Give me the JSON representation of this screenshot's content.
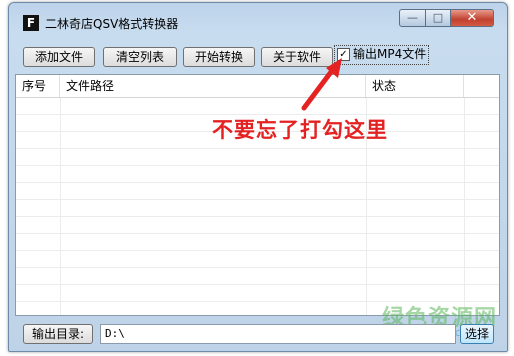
{
  "window": {
    "title": "二林奇店QSV格式转换器",
    "app_icon_letter": "F",
    "controls": {
      "minimize": "—",
      "maximize": "□",
      "close": "✕"
    }
  },
  "toolbar": {
    "add_file": "添加文件",
    "clear_list": "清空列表",
    "start_convert": "开始转换",
    "about": "关于软件",
    "output_mp4_label": "输出MP4文件",
    "output_mp4_checked": "✓"
  },
  "file_list": {
    "columns": [
      "序号",
      "文件路径",
      "状态"
    ],
    "rows": []
  },
  "annotation": {
    "text": "不要忘了打勾这里",
    "color": "#e42222"
  },
  "bottom": {
    "output_dir_label": "输出目录:",
    "output_dir_value": "D:\\",
    "select_label": "选择"
  },
  "watermark": {
    "main": "绿色资源网",
    "sub": "www.downcc.com"
  }
}
